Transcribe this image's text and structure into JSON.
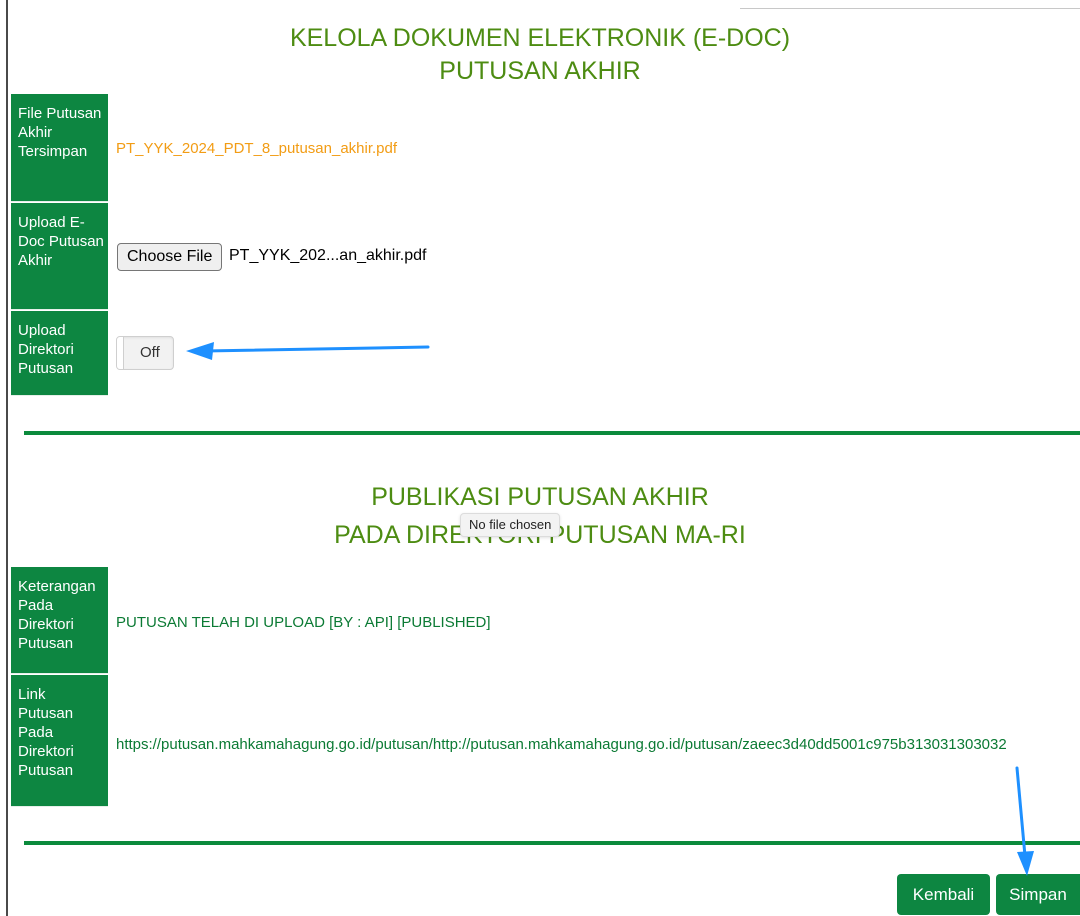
{
  "header": {
    "title_line1": "KELOLA DOKUMEN ELEKTRONIK (E-DOC)",
    "title_line2": "PUTUSAN AKHIR"
  },
  "form": {
    "file_saved": {
      "label": "File Putusan Akhir Tersimpan",
      "value": "PT_YYK_2024_PDT_8_putusan_akhir.pdf"
    },
    "upload_edoc": {
      "label": "Upload E-Doc Putusan Akhir",
      "button_label": "Choose File",
      "chosen_file": "PT_YYK_202...an_akhir.pdf"
    },
    "upload_directory": {
      "label": "Upload Direktori Putusan",
      "toggle_label": "Off",
      "toggle_state": false
    }
  },
  "publication": {
    "title_line1": "PUBLIKASI PUTUSAN AKHIR",
    "title_line2": "PADA DIREKTORI PUTUSAN MA-RI",
    "tooltip": "No file chosen",
    "note": {
      "label": "Keterangan Pada Direktori Putusan",
      "value": "PUTUSAN TELAH DI UPLOAD [BY : API] [PUBLISHED]"
    },
    "link": {
      "label": "Link Putusan Pada Direktori Putusan",
      "value": "https://putusan.mahkamahagung.go.id/putusan/http://putusan.mahkamahagung.go.id/putusan/zaeec3d40dd5001c975b313031303032"
    }
  },
  "actions": {
    "back_label": "Kembali",
    "save_label": "Simpan"
  },
  "colors": {
    "label_bg": "#0d8641",
    "title_text": "#4d8c12",
    "saved_file_text": "#f29c14",
    "value_text": "#0b7a34",
    "annotation_arrow": "#1e90ff"
  }
}
